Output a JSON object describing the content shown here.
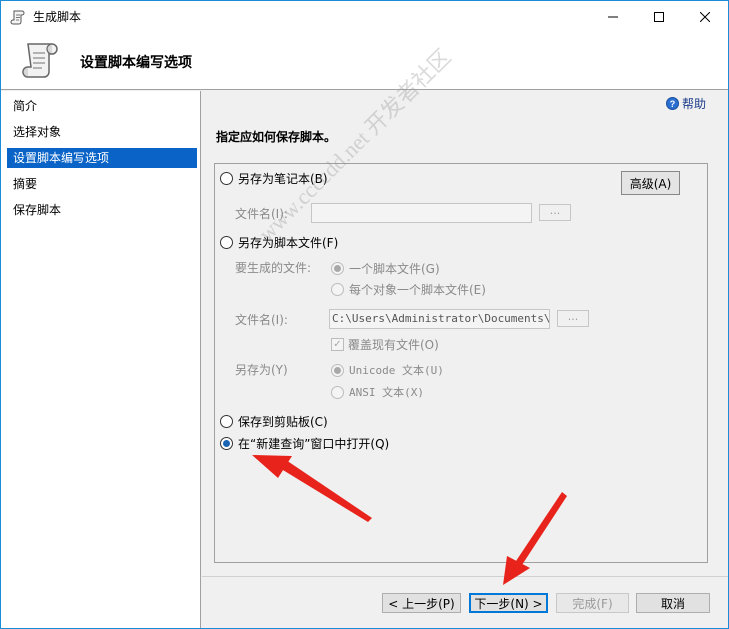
{
  "window": {
    "title": "生成脚本",
    "controls": {
      "minimize": "minimize",
      "maximize": "maximize",
      "close": "close"
    }
  },
  "header": {
    "title": "设置脚本编写选项"
  },
  "nav": {
    "items": [
      {
        "label": "简介",
        "active": false
      },
      {
        "label": "选择对象",
        "active": false
      },
      {
        "label": "设置脚本编写选项",
        "active": true
      },
      {
        "label": "摘要",
        "active": false
      },
      {
        "label": "保存脚本",
        "active": false
      }
    ]
  },
  "main": {
    "help_label": "帮助",
    "instruction": "指定应如何保存脚本。",
    "advanced_button": "高级(A)",
    "save_as_notebook": {
      "label": "另存为笔记本(B)",
      "selected": false,
      "filename_label": "文件名(I):",
      "filename_value": "",
      "browse_label": "..."
    },
    "save_as_script": {
      "label": "另存为脚本文件(F)",
      "selected": false,
      "files_to_generate_label": "要生成的文件:",
      "single_file": "一个脚本文件(G)",
      "file_per_object": "每个对象一个脚本文件(E)",
      "filename_label": "文件名(I):",
      "filename_value": "C:\\Users\\Administrator\\Documents\\scr",
      "browse_label": "...",
      "overwrite_label": "覆盖现有文件(O)",
      "overwrite_checked": true,
      "save_as_label": "另存为(Y)",
      "unicode_text": "Unicode 文本(U)",
      "ansi_text": "ANSI 文本(X)"
    },
    "save_to_clipboard": {
      "label": "保存到剪贴板(C)",
      "selected": false
    },
    "open_in_new_query": {
      "label": "在“新建查询”窗口中打开(Q)",
      "selected": true
    }
  },
  "buttons": {
    "previous": "< 上一步(P)",
    "next": "下一步(N) >",
    "finish": "完成(F)",
    "cancel": "取消"
  },
  "watermark": "www.ccccdd.net 开发者社区",
  "colors": {
    "selection": "#0a64c8",
    "accent_border": "#0078d7",
    "arrow": "#e8231b"
  }
}
